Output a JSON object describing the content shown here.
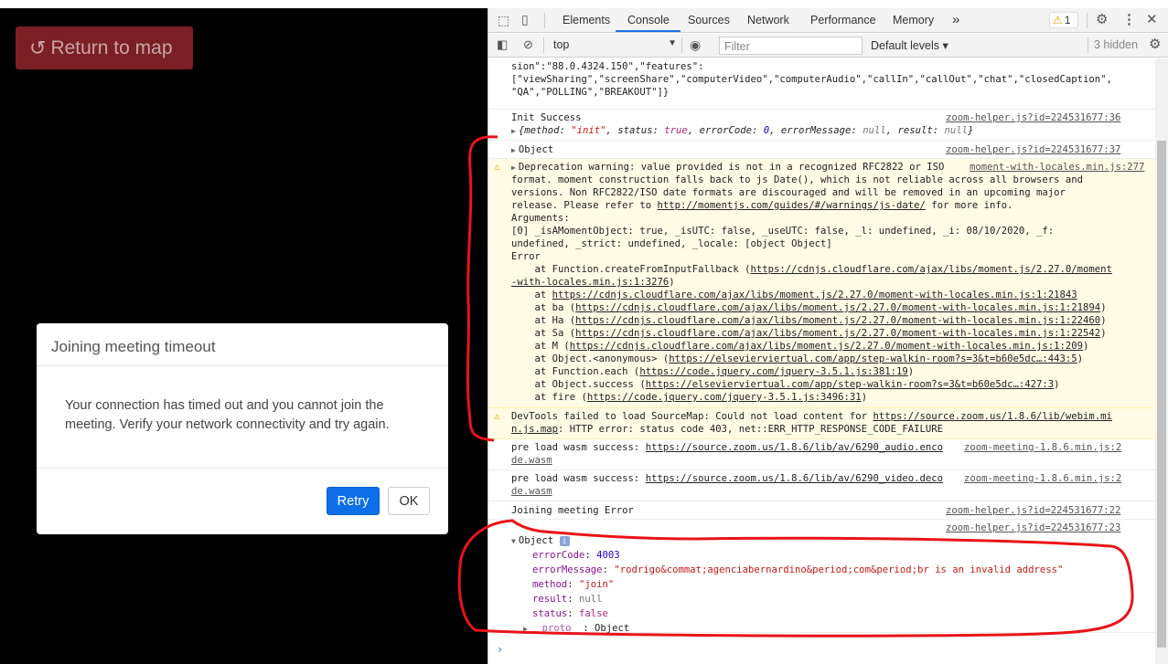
{
  "app": {
    "return_label": "Return to map",
    "modal": {
      "title": "Joining meeting timeout",
      "body_line1": "Your connection has timed out and you cannot join the",
      "body_line2": "meeting. Verify your network connectivity and try again.",
      "retry": "Retry",
      "ok": "OK"
    }
  },
  "devtools": {
    "tabs": [
      "Elements",
      "Console",
      "Sources",
      "Network",
      "Performance",
      "Memory"
    ],
    "more": "»",
    "warning_count": "1",
    "context": "top",
    "filter_placeholder": "Filter",
    "levels": "Default levels",
    "hidden": "3 hidden",
    "prompt": "›"
  },
  "console": {
    "e0": {
      "l1": "sion\":\"88.0.4324.150\",\"features\":",
      "l2": "[\"viewSharing\",\"screenShare\",\"computerVideo\",\"computerAudio\",\"callIn\",\"callOut\",\"chat\",\"closedCaption\",",
      "l3": "\"QA\",\"POLLING\",\"BREAKOUT\"]}"
    },
    "e1": {
      "text": "Init Success",
      "src": "zoom-helper.js?id=224531677:36",
      "obj_a": "{method: ",
      "obj_b": "\"init\"",
      "obj_c": ", status: ",
      "obj_d": "true",
      "obj_e": ", errorCode: ",
      "obj_f": "0",
      "obj_g": ", errorMessage: ",
      "obj_h": "null",
      "obj_i": ", result: ",
      "obj_j": "null",
      "obj_k": "}"
    },
    "e2": {
      "text": "Object",
      "src": "zoom-helper.js?id=224531677:37"
    },
    "e3": {
      "src": "moment-with-locales.min.js:277",
      "l1": "Deprecation warning: value provided is not in a recognized RFC2822 or ISO",
      "l2": "format. moment construction falls back to js Date(), which is not reliable across all browsers and",
      "l3": "versions. Non RFC2822/ISO date formats are discouraged and will be removed in an upcoming major",
      "l4a": "release. Please refer to ",
      "l4b": "http://momentjs.com/guides/#/warnings/js-date/",
      "l4c": " for more info.",
      "l5": "Arguments:",
      "l6": "[0] _isAMomentObject: true, _isUTC: false, _useUTC: false, _l: undefined, _i: 08/10/2020, _f:",
      "l7": "undefined, _strict: undefined, _locale: [object Object]",
      "l8": "Error",
      "l9a": "    at Function.createFromInputFallback (",
      "l9b": "https://cdnjs.cloudflare.com/ajax/libs/moment.js/2.27.0/moment",
      "l10a": "-with-locales.min.js:1:3276",
      "l10b": ")",
      "l11a": "    at ",
      "l11b": "https://cdnjs.cloudflare.com/ajax/libs/moment.js/2.27.0/moment-with-locales.min.js:1:21843",
      "l12a": "    at ba (",
      "l12b": "https://cdnjs.cloudflare.com/ajax/libs/moment.js/2.27.0/moment-with-locales.min.js:1:21894",
      "l12c": ")",
      "l13a": "    at Ha (",
      "l13b": "https://cdnjs.cloudflare.com/ajax/libs/moment.js/2.27.0/moment-with-locales.min.js:1:22460",
      "l13c": ")",
      "l14a": "    at Sa (",
      "l14b": "https://cdnjs.cloudflare.com/ajax/libs/moment.js/2.27.0/moment-with-locales.min.js:1:22542",
      "l14c": ")",
      "l15a": "    at M (",
      "l15b": "https://cdnjs.cloudflare.com/ajax/libs/moment.js/2.27.0/moment-with-locales.min.js:1:209",
      "l15c": ")",
      "l16a": "    at Object.<anonymous> (",
      "l16b": "https://elsevierviertual.com/app/step-walkin-room?s=3&t=b60e5dc…:443:5",
      "l16c": ")",
      "l17a": "    at Function.each (",
      "l17b": "https://code.jquery.com/jquery-3.5.1.js:381:19",
      "l17c": ")",
      "l18a": "    at Object.success (",
      "l18b": "https://elsevierviertual.com/app/step-walkin-room?s=3&t=b60e5dc…:427:3",
      "l18c": ")",
      "l19a": "    at fire (",
      "l19b": "https://code.jquery.com/jquery-3.5.1.js:3496:31",
      "l19c": ")"
    },
    "e4": {
      "l1a": "DevTools failed to load SourceMap: Could not load content for ",
      "l1b": "https://source.zoom.us/1.8.6/lib/webim.mi",
      "l2a": "n.js.map",
      "l2b": ": HTTP error: status code 403, net::ERR_HTTP_RESPONSE_CODE_FAILURE"
    },
    "e5": {
      "l1a": "pre load wasm success: ",
      "l1b": "https://source.zoom.us/1.8.6/lib/av/6290_audio.enco",
      "src1": "zoom-meeting-1.8.6.min.js:2",
      "l2": "de.wasm"
    },
    "e6": {
      "l1a": "pre load wasm success: ",
      "l1b": "https://source.zoom.us/1.8.6/lib/av/6290_video.deco",
      "src1": "zoom-meeting-1.8.6.min.js:2",
      "l2": "de.wasm"
    },
    "e7": {
      "text": "Joining meeting Error",
      "src": "zoom-helper.js?id=224531677:22"
    },
    "e8": {
      "src": "zoom-helper.js?id=224531677:23",
      "obj": "Object",
      "info": "i",
      "k1": "errorCode",
      "v1": "4003",
      "k2": "errorMessage",
      "v2": "\"rodrigo&commat;agenciabernardino&period;com&period;br is an invalid address\"",
      "k3": "method",
      "v3": "\"join\"",
      "k4": "result",
      "v4": "null",
      "k5": "status",
      "v5": "false",
      "k6": "__proto__",
      "v6": "Object",
      "sep": ": "
    }
  },
  "colors": {
    "return_button": "#7a1f24",
    "retry_button": "#0d6ee8",
    "warning_bg": "#fffbe5",
    "annotation_red": "#e8141a",
    "tab_underline": "#1a73e8"
  }
}
